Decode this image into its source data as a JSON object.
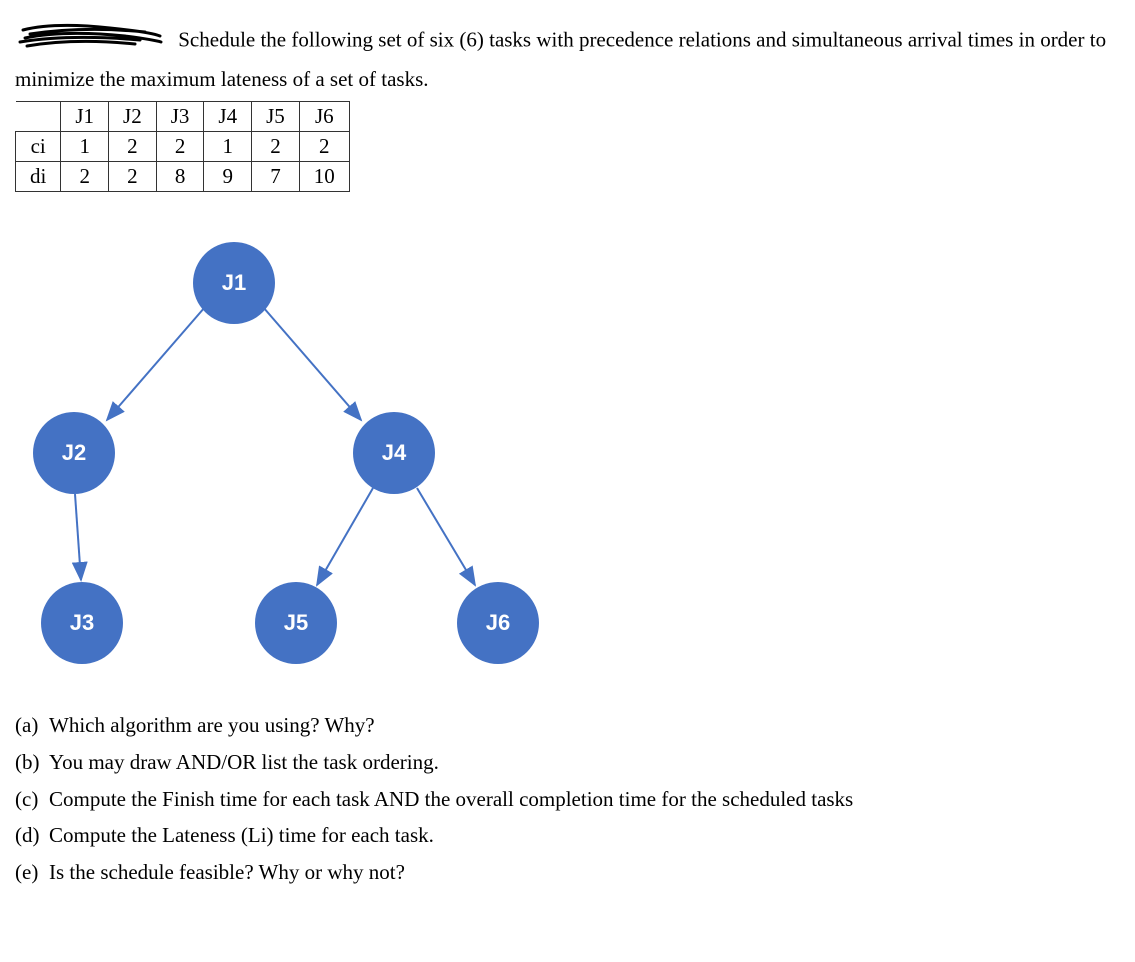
{
  "intro_text": "Schedule the following set of six (6) tasks with precedence relations and simultaneous arrival times in order to minimize the maximum lateness of a set of tasks.",
  "table": {
    "headers": [
      "",
      "J1",
      "J2",
      "J3",
      "J4",
      "J5",
      "J6"
    ],
    "rows": [
      {
        "label": "ci",
        "cells": [
          "1",
          "2",
          "2",
          "1",
          "2",
          "2"
        ]
      },
      {
        "label": "di",
        "cells": [
          "2",
          "2",
          "8",
          "9",
          "7",
          "10"
        ]
      }
    ]
  },
  "nodes": {
    "j1": "J1",
    "j2": "J2",
    "j3": "J3",
    "j4": "J4",
    "j5": "J5",
    "j6": "J6"
  },
  "questions": {
    "a": {
      "label": "(a)",
      "text": "Which algorithm are you using? Why?"
    },
    "b": {
      "label": "(b)",
      "text": "You may draw AND/OR list the task ordering."
    },
    "c": {
      "label": "(c)",
      "text": "Compute the Finish time for each task AND the overall completion time for the scheduled tasks"
    },
    "d": {
      "label": "(d)",
      "text": "Compute the Lateness (Li) time for each task."
    },
    "e": {
      "label": "(e)",
      "text": "Is the schedule feasible? Why or why not?"
    }
  }
}
